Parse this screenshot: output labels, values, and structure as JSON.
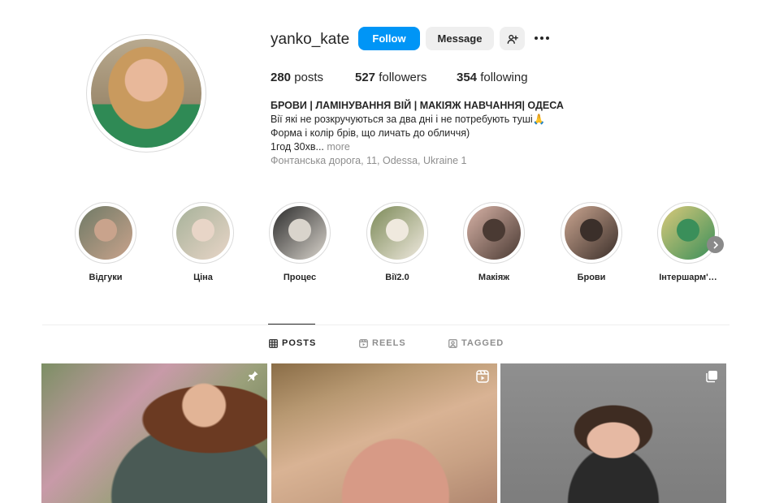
{
  "profile": {
    "username": "yanko_kate",
    "follow_label": "Follow",
    "message_label": "Message",
    "stats": {
      "posts_count": "280",
      "posts_label": "posts",
      "followers_count": "527",
      "followers_label": "followers",
      "following_count": "354",
      "following_label": "following"
    },
    "bio": {
      "title": "БРОВИ | ЛАМІНУВАННЯ ВІЙ | МАКІЯЖ НАВЧАННЯ| ОДЕСА",
      "line1": "Вії які не розкручуються за два дні і не потребують туші🙏",
      "line2": "Форма і колір брів, що личать до обличчя)",
      "line3": "1год 30хв...",
      "more_label": "more",
      "address": "Фонтанська дорога, 11, Odessa, Ukraine 1"
    }
  },
  "highlights": [
    {
      "label": "Відгуки",
      "colors": [
        "#6f7a66",
        "#c9a38c"
      ]
    },
    {
      "label": "Ціна",
      "colors": [
        "#a7b29a",
        "#e8d5c7"
      ]
    },
    {
      "label": "Процес",
      "colors": [
        "#2b2b2b",
        "#d9d4cc"
      ]
    },
    {
      "label": "Вії2.0",
      "colors": [
        "#7c8a58",
        "#efe9de"
      ]
    },
    {
      "label": "Макіяж",
      "colors": [
        "#d7b2a6",
        "#4a3a33"
      ]
    },
    {
      "label": "Брови",
      "colors": [
        "#caa590",
        "#3b2f2a"
      ]
    },
    {
      "label": "Інтершарм'…",
      "colors": [
        "#d9c97a",
        "#3a8f5a"
      ]
    }
  ],
  "tabs": [
    {
      "label": "POSTS",
      "active": true
    },
    {
      "label": "REELS",
      "active": false
    },
    {
      "label": "TAGGED",
      "active": false
    }
  ],
  "colors": {
    "accent": "#0095f6",
    "text": "#262626",
    "muted": "#8e8e8e",
    "border": "#dbdbdb"
  }
}
